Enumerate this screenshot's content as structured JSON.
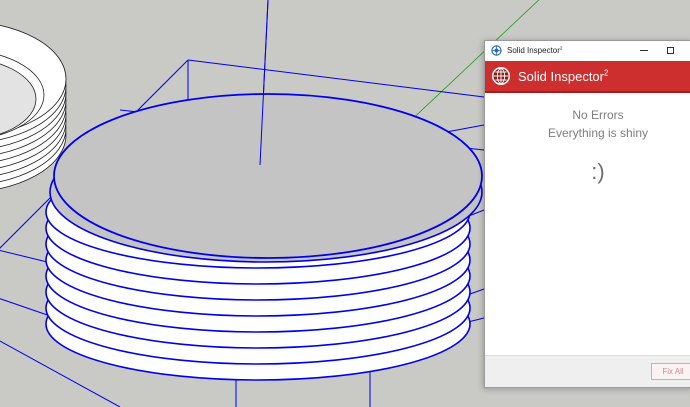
{
  "window": {
    "title": "Solid Inspector",
    "title_superscript": "2",
    "brand_title": "Solid Inspector",
    "brand_superscript": "2",
    "app_icon": "solid-inspector-app-icon",
    "brand_icon": "inspector-globe-logo-icon",
    "controls": {
      "minimize_icon": "minimize-icon",
      "maximize_icon": "maximize-icon"
    }
  },
  "status": {
    "line1": "No Errors",
    "line2": "Everything is shiny",
    "emoticon": ":)"
  },
  "footer": {
    "fix_all_label": "Fix All"
  },
  "colors": {
    "accent": "#cc2f2e",
    "viewport_background": "#c9c9c6",
    "selection_edges": "#0000ee",
    "model_face": "#c4c4c4",
    "axis_green": "#1ea11e"
  }
}
